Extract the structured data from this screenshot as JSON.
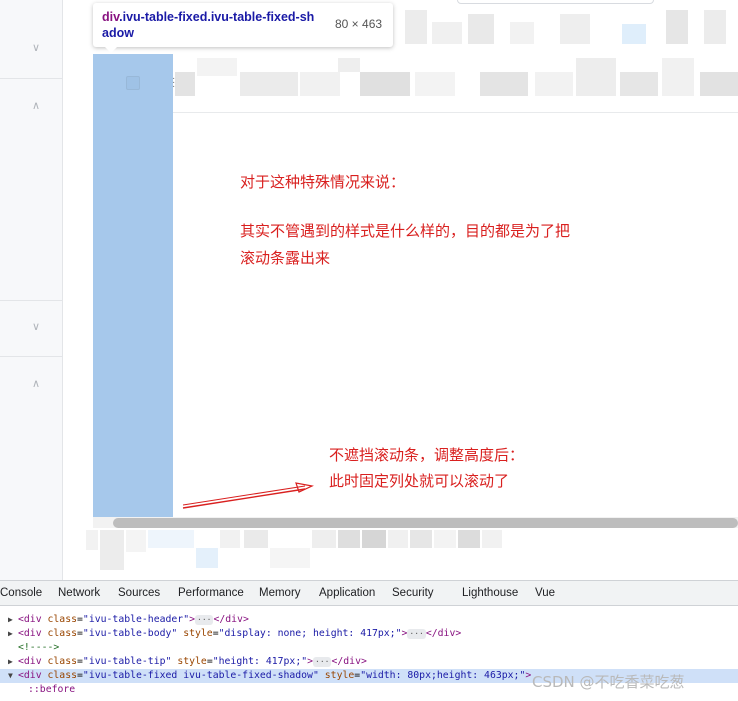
{
  "tooltip": {
    "tag": "div",
    "classes_line1": ".ivu-table-fixed.ivu-table-fixed-sh",
    "classes_line2": "adow",
    "size": "80 × 463"
  },
  "annotations": {
    "line1": "对于这种特殊情况来说：",
    "line2": "其实不管遇到的样式是什么样的，目的都是为了把",
    "line3": "滚动条露出来",
    "line4": "不遮挡滚动条，调整高度后：",
    "line5": "此时固定列处就可以滚动了"
  },
  "devtools": {
    "tabs": [
      "Console",
      "Network",
      "Sources",
      "Performance",
      "Memory",
      "Application",
      "Security",
      "Lighthouse",
      "Vue"
    ],
    "lines": [
      {
        "tag": "div",
        "attr": "class",
        "value": "ivu-table-header"
      },
      {
        "tag": "div",
        "attr": "class",
        "value": "ivu-table-body",
        "attr2": "style",
        "value2": "display: none; height: 417px;"
      },
      {
        "comment": "<!---->"
      },
      {
        "tag": "div",
        "attr": "class",
        "value": "ivu-table-tip",
        "attr2": "style",
        "value2": "height: 417px;"
      },
      {
        "tag": "div",
        "attr": "class",
        "value": "ivu-table-fixed ivu-table-fixed-shadow",
        "attr2": "style",
        "value2": "width: 80px;height: 463px;"
      },
      {
        "pseudo": "::before"
      }
    ]
  },
  "watermark": "CSDN @不吃香菜吃葱",
  "colors": {
    "highlight": "#a6c8eb",
    "annotation": "#d9201f",
    "scrollbar": "#bdbdbd"
  }
}
